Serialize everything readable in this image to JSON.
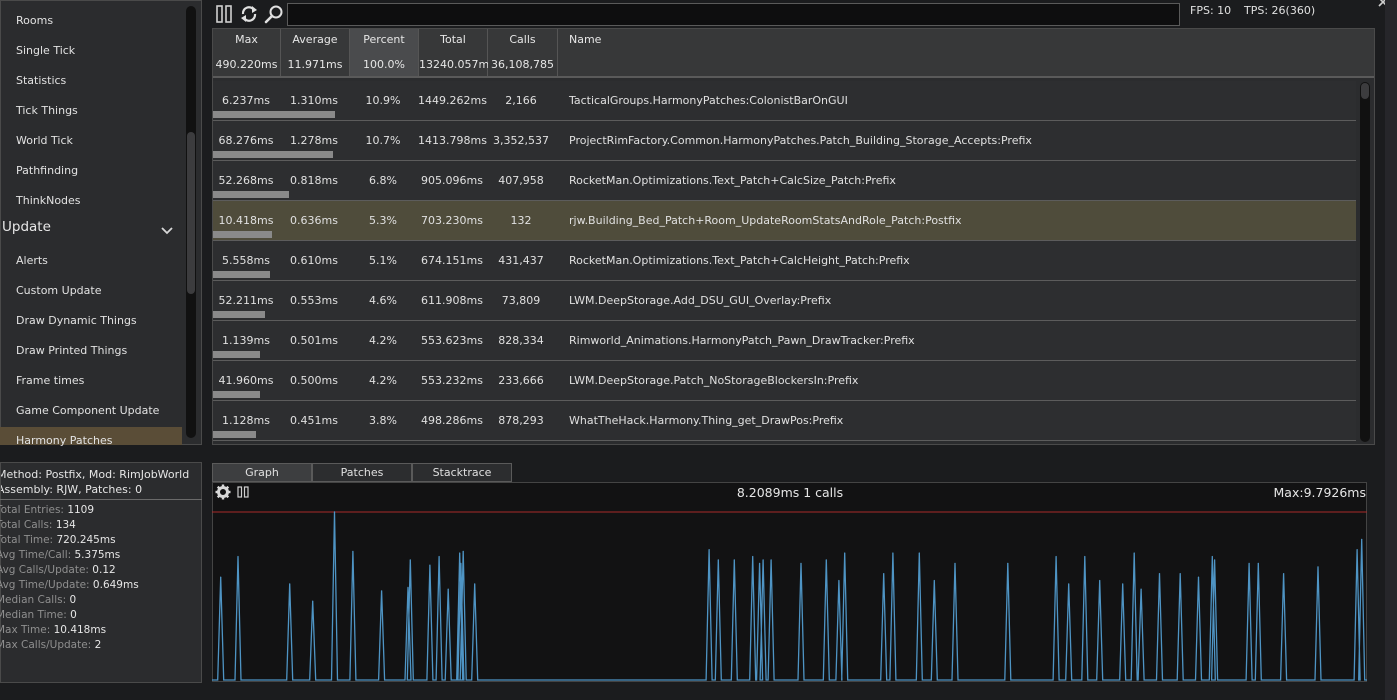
{
  "sidebar": {
    "items_top": [
      "Rooms",
      "Single Tick",
      "Statistics",
      "Tick Things",
      "World Tick",
      "Pathfinding",
      "ThinkNodes"
    ],
    "category": "Update",
    "items_update": [
      "Alerts",
      "Custom Update",
      "Draw Dynamic Things",
      "Draw Printed Things",
      "Frame times",
      "Game Component Update",
      "Harmony Patches"
    ]
  },
  "toolbar": {
    "search_value": "",
    "fps": "FPS: 10",
    "tps": "TPS: 26(360)"
  },
  "table": {
    "columns": [
      {
        "label": "Max",
        "value": "490.220ms"
      },
      {
        "label": "Average",
        "value": "11.971ms"
      },
      {
        "label": "Percent",
        "value": "100.0%"
      },
      {
        "label": "Total",
        "value": "13240.057ms"
      },
      {
        "label": "Calls",
        "value": "36,108,785"
      }
    ],
    "name_label": "Name",
    "rows": [
      {
        "max": "6.237ms",
        "avg": "1.310ms",
        "pct": "10.9%",
        "total": "1449.262ms",
        "calls": "2,166",
        "name": "TacticalGroups.HarmonyPatches:ColonistBarOnGUI",
        "bar": 0.109,
        "selected": false
      },
      {
        "max": "68.276ms",
        "avg": "1.278ms",
        "pct": "10.7%",
        "total": "1413.798ms",
        "calls": "3,352,537",
        "name": "ProjectRimFactory.Common.HarmonyPatches.Patch_Building_Storage_Accepts:Prefix",
        "bar": 0.107,
        "selected": false
      },
      {
        "max": "52.268ms",
        "avg": "0.818ms",
        "pct": "6.8%",
        "total": "905.096ms",
        "calls": "407,958",
        "name": "RocketMan.Optimizations.Text_Patch+CalcSize_Patch:Prefix",
        "bar": 0.068,
        "selected": false
      },
      {
        "max": "10.418ms",
        "avg": "0.636ms",
        "pct": "5.3%",
        "total": "703.230ms",
        "calls": "132",
        "name": "rjw.Building_Bed_Patch+Room_UpdateRoomStatsAndRole_Patch:Postfix",
        "bar": 0.053,
        "selected": true
      },
      {
        "max": "5.558ms",
        "avg": "0.610ms",
        "pct": "5.1%",
        "total": "674.151ms",
        "calls": "431,437",
        "name": "RocketMan.Optimizations.Text_Patch+CalcHeight_Patch:Prefix",
        "bar": 0.051,
        "selected": false
      },
      {
        "max": "52.211ms",
        "avg": "0.553ms",
        "pct": "4.6%",
        "total": "611.908ms",
        "calls": "73,809",
        "name": "LWM.DeepStorage.Add_DSU_GUI_Overlay:Prefix",
        "bar": 0.046,
        "selected": false
      },
      {
        "max": "1.139ms",
        "avg": "0.501ms",
        "pct": "4.2%",
        "total": "553.623ms",
        "calls": "828,334",
        "name": "Rimworld_Animations.HarmonyPatch_Pawn_DrawTracker:Prefix",
        "bar": 0.042,
        "selected": false
      },
      {
        "max": "41.960ms",
        "avg": "0.500ms",
        "pct": "4.2%",
        "total": "553.232ms",
        "calls": "233,666",
        "name": "LWM.DeepStorage.Patch_NoStorageBlockersIn:Prefix",
        "bar": 0.042,
        "selected": false
      },
      {
        "max": "1.128ms",
        "avg": "0.451ms",
        "pct": "3.8%",
        "total": "498.286ms",
        "calls": "878,293",
        "name": "WhatTheHack.Harmony.Thing_get_DrawPos:Prefix",
        "bar": 0.038,
        "selected": false
      }
    ]
  },
  "info": {
    "line1": "Method: Postfix, Mod: RimJobWorld",
    "line2": "Assembly: RJW, Patches: 0",
    "stats": [
      {
        "key": "Total Entries: ",
        "value": "1109"
      },
      {
        "key": "Total Calls: ",
        "value": "134"
      },
      {
        "key": "Total Time: ",
        "value": "720.245ms"
      },
      {
        "key": "Avg Time/Call: ",
        "value": "5.375ms"
      },
      {
        "key": "Avg Calls/Update: ",
        "value": "0.12"
      },
      {
        "key": "Avg Time/Update: ",
        "value": "0.649ms"
      },
      {
        "key": "Median Calls: ",
        "value": "0"
      },
      {
        "key": "Median Time: ",
        "value": "0"
      },
      {
        "key": "Max Time: ",
        "value": "10.418ms"
      },
      {
        "key": "Max Calls/Update: ",
        "value": "2"
      }
    ]
  },
  "tabs": [
    "Graph",
    "Patches",
    "Stacktrace"
  ],
  "graph": {
    "status": "8.2089ms 1 calls",
    "max_label": "Max:9.7926ms",
    "line_color": "#4e94c4",
    "max_line_color": "#a82a2a"
  },
  "chart_data": {
    "type": "line",
    "ymax": 9.7926,
    "spikes": [
      {
        "i": 0.005,
        "v": 6.0
      },
      {
        "i": 0.02,
        "v": 7.2
      },
      {
        "i": 0.065,
        "v": 5.6
      },
      {
        "i": 0.085,
        "v": 4.6
      },
      {
        "i": 0.104,
        "v": 9.8
      },
      {
        "i": 0.12,
        "v": 7.5
      },
      {
        "i": 0.145,
        "v": 5.2
      },
      {
        "i": 0.168,
        "v": 5.4
      },
      {
        "i": 0.17,
        "v": 7.0
      },
      {
        "i": 0.187,
        "v": 6.7
      },
      {
        "i": 0.195,
        "v": 7.2
      },
      {
        "i": 0.203,
        "v": 5.3
      },
      {
        "i": 0.214,
        "v": 6.8
      },
      {
        "i": 0.216,
        "v": 7.5
      },
      {
        "i": 0.213,
        "v": 7.4
      },
      {
        "i": 0.226,
        "v": 5.6
      },
      {
        "i": 0.43,
        "v": 7.6
      },
      {
        "i": 0.438,
        "v": 7.0
      },
      {
        "i": 0.452,
        "v": 7.0
      },
      {
        "i": 0.468,
        "v": 7.2
      },
      {
        "i": 0.474,
        "v": 6.8
      },
      {
        "i": 0.477,
        "v": 7.0
      },
      {
        "i": 0.484,
        "v": 7.0
      },
      {
        "i": 0.51,
        "v": 6.8
      },
      {
        "i": 0.532,
        "v": 7.0
      },
      {
        "i": 0.543,
        "v": 5.8
      },
      {
        "i": 0.548,
        "v": 7.4
      },
      {
        "i": 0.582,
        "v": 6.2
      },
      {
        "i": 0.59,
        "v": 7.4
      },
      {
        "i": 0.613,
        "v": 7.4
      },
      {
        "i": 0.626,
        "v": 5.8
      },
      {
        "i": 0.644,
        "v": 6.8
      },
      {
        "i": 0.69,
        "v": 6.8
      },
      {
        "i": 0.732,
        "v": 7.2
      },
      {
        "i": 0.743,
        "v": 5.6
      },
      {
        "i": 0.757,
        "v": 7.2
      },
      {
        "i": 0.77,
        "v": 5.8
      },
      {
        "i": 0.79,
        "v": 5.6
      },
      {
        "i": 0.8,
        "v": 7.4
      },
      {
        "i": 0.806,
        "v": 5.3
      },
      {
        "i": 0.822,
        "v": 6.2
      },
      {
        "i": 0.84,
        "v": 6.2
      },
      {
        "i": 0.856,
        "v": 6.0
      },
      {
        "i": 0.868,
        "v": 7.2
      },
      {
        "i": 0.87,
        "v": 7.0
      },
      {
        "i": 0.9,
        "v": 6.8
      },
      {
        "i": 0.908,
        "v": 6.8
      },
      {
        "i": 0.93,
        "v": 6.2
      },
      {
        "i": 0.96,
        "v": 6.6
      },
      {
        "i": 0.994,
        "v": 7.6
      },
      {
        "i": 0.998,
        "v": 8.2
      }
    ]
  }
}
